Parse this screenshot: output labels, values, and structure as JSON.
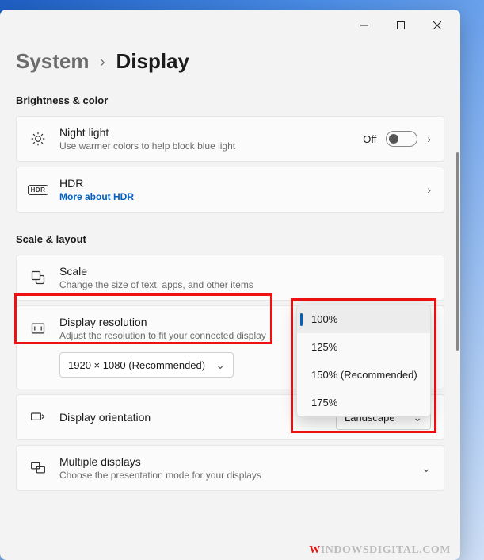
{
  "breadcrumb": {
    "parent": "System",
    "current": "Display"
  },
  "sections": {
    "brightness": "Brightness & color",
    "scale_layout": "Scale & layout"
  },
  "night_light": {
    "title": "Night light",
    "desc": "Use warmer colors to help block blue light",
    "state": "Off"
  },
  "hdr": {
    "title": "HDR",
    "link": "More about HDR"
  },
  "scale": {
    "title": "Scale",
    "desc": "Change the size of text, apps, and other items",
    "options": [
      "100%",
      "125%",
      "150% (Recommended)",
      "175%"
    ],
    "selected_index": 0
  },
  "resolution": {
    "title": "Display resolution",
    "desc": "Adjust the resolution to fit your connected display",
    "value": "1920 × 1080 (Recommended)"
  },
  "orientation": {
    "title": "Display orientation",
    "value": "Landscape"
  },
  "multiple": {
    "title": "Multiple displays",
    "desc": "Choose the presentation mode for your displays"
  },
  "watermark": {
    "w": "W",
    "rest": "INDOWSDIGITAL.COM"
  }
}
